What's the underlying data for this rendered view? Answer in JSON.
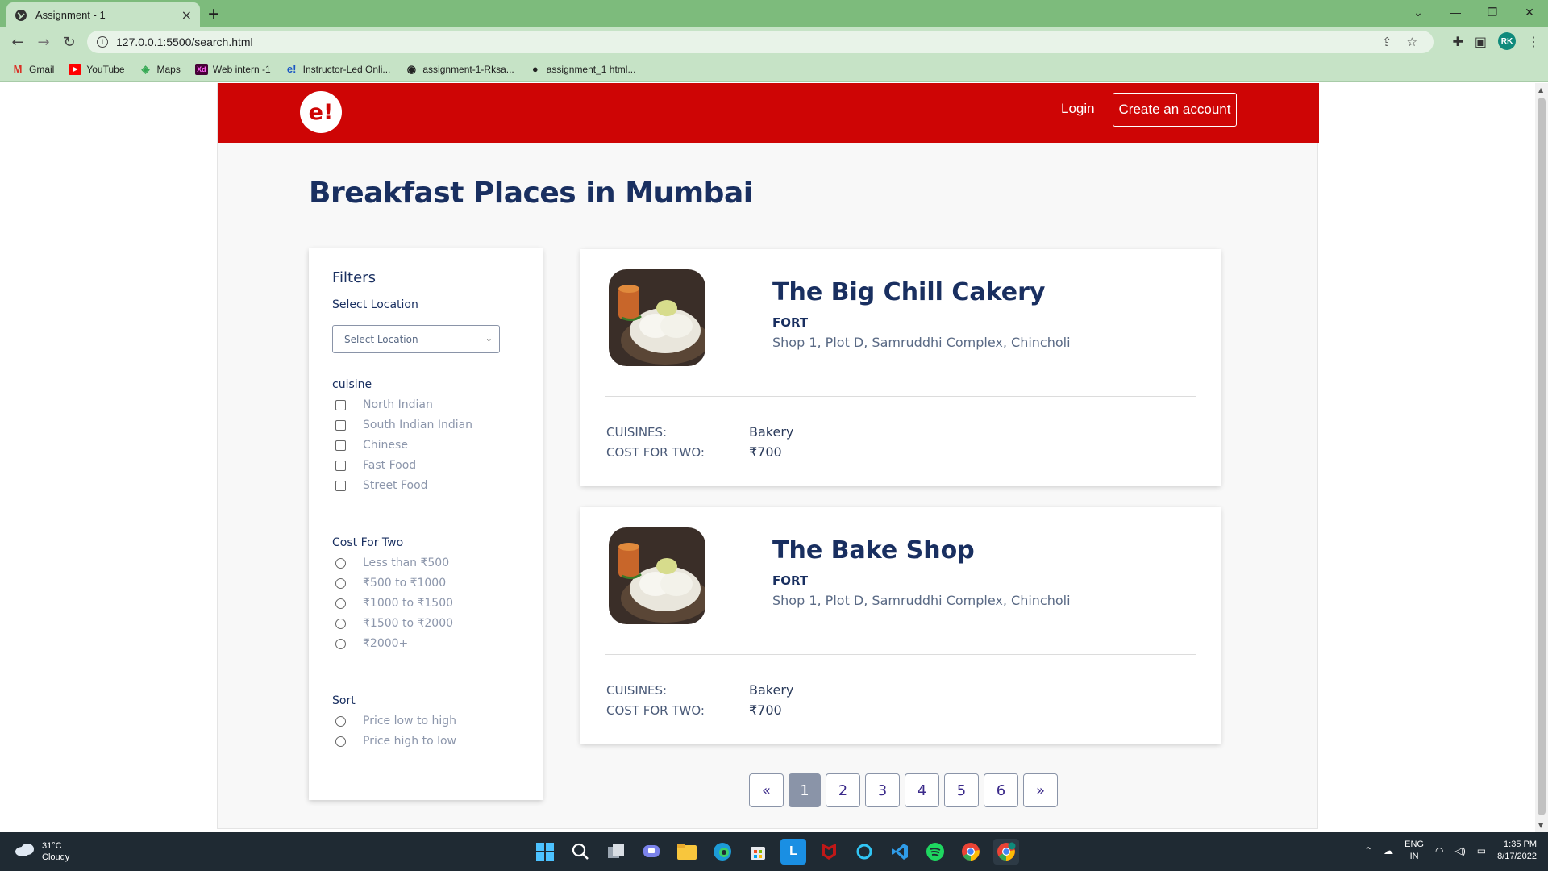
{
  "browser": {
    "tab_title": "Assignment - 1",
    "tab_close": "×",
    "new_tab": "+",
    "url": "127.0.0.1:5500/search.html",
    "bookmarks": [
      {
        "label": "Gmail",
        "icon": "gmail-icon"
      },
      {
        "label": "YouTube",
        "icon": "youtube-icon"
      },
      {
        "label": "Maps",
        "icon": "maps-icon"
      },
      {
        "label": "Web intern -1",
        "icon": "xd-icon"
      },
      {
        "label": "Instructor-Led Onli...",
        "icon": "edureka-icon"
      },
      {
        "label": "assignment-1-Rksa...",
        "icon": "github-icon"
      },
      {
        "label": "assignment_1 html...",
        "icon": "globe-icon"
      }
    ],
    "profile_initials": "RK"
  },
  "header": {
    "logo_text": "e!",
    "login_label": "Login",
    "create_account_label": "Create an account"
  },
  "page_title": "Breakfast Places in Mumbai",
  "filters": {
    "title": "Filters",
    "location_label": "Select Location",
    "location_select_value": "Select Location",
    "cuisine_label": "cuisine",
    "cuisines": [
      "North Indian",
      "South Indian Indian",
      "Chinese",
      "Fast Food",
      "Street Food"
    ],
    "cost_label": "Cost For Two",
    "costs": [
      "Less than ₹500",
      "₹500 to ₹1000",
      "₹1000 to ₹1500",
      "₹1500 to ₹2000",
      "₹2000+"
    ],
    "sort_label": "Sort",
    "sorts": [
      "Price low to high",
      "Price high to low"
    ]
  },
  "results": [
    {
      "name": "The Big Chill Cakery",
      "locality": "FORT",
      "address": "Shop 1, Plot D, Samruddhi Complex, Chincholi",
      "cuisines_label": "CUISINES:",
      "cuisines_value": "Bakery",
      "cost_label": "COST FOR TWO:",
      "cost_value": "₹700"
    },
    {
      "name": "The Bake Shop",
      "locality": "FORT",
      "address": "Shop 1, Plot D, Samruddhi Complex, Chincholi",
      "cuisines_label": "CUISINES:",
      "cuisines_value": "Bakery",
      "cost_label": "COST FOR TWO:",
      "cost_value": "₹700"
    }
  ],
  "pagination": {
    "prev": "«",
    "pages": [
      "1",
      "2",
      "3",
      "4",
      "5",
      "6"
    ],
    "active_page": "1",
    "next": "»"
  },
  "taskbar": {
    "temperature": "31°C",
    "weather": "Cloudy",
    "language_top": "ENG",
    "language_bottom": "IN",
    "time": "1:35 PM",
    "date": "8/17/2022"
  },
  "colors": {
    "brand_red": "#ce0505",
    "title_navy": "#192f60",
    "browser_green": "#7dbb7c"
  }
}
